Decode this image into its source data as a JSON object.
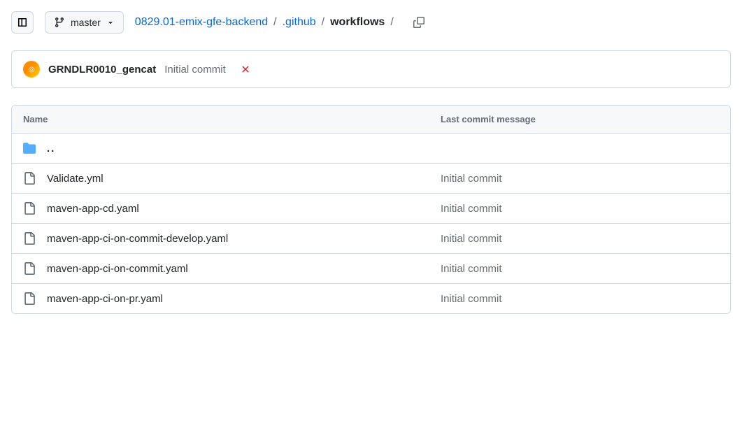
{
  "toolbar": {
    "branch_label": "master"
  },
  "breadcrumb": {
    "repo": "0829.01-emix-gfe-backend",
    "path1": ".github",
    "current": "workflows",
    "sep": "/"
  },
  "commit": {
    "author": "GRNDLR0010_gencat",
    "message": "Initial commit"
  },
  "table": {
    "header_name": "Name",
    "header_msg": "Last commit message",
    "parent_label": "..",
    "rows": [
      {
        "name": "Validate.yml",
        "msg": "Initial commit"
      },
      {
        "name": "maven-app-cd.yaml",
        "msg": "Initial commit"
      },
      {
        "name": "maven-app-ci-on-commit-develop.yaml",
        "msg": "Initial commit"
      },
      {
        "name": "maven-app-ci-on-commit.yaml",
        "msg": "Initial commit"
      },
      {
        "name": "maven-app-ci-on-pr.yaml",
        "msg": "Initial commit"
      }
    ]
  }
}
